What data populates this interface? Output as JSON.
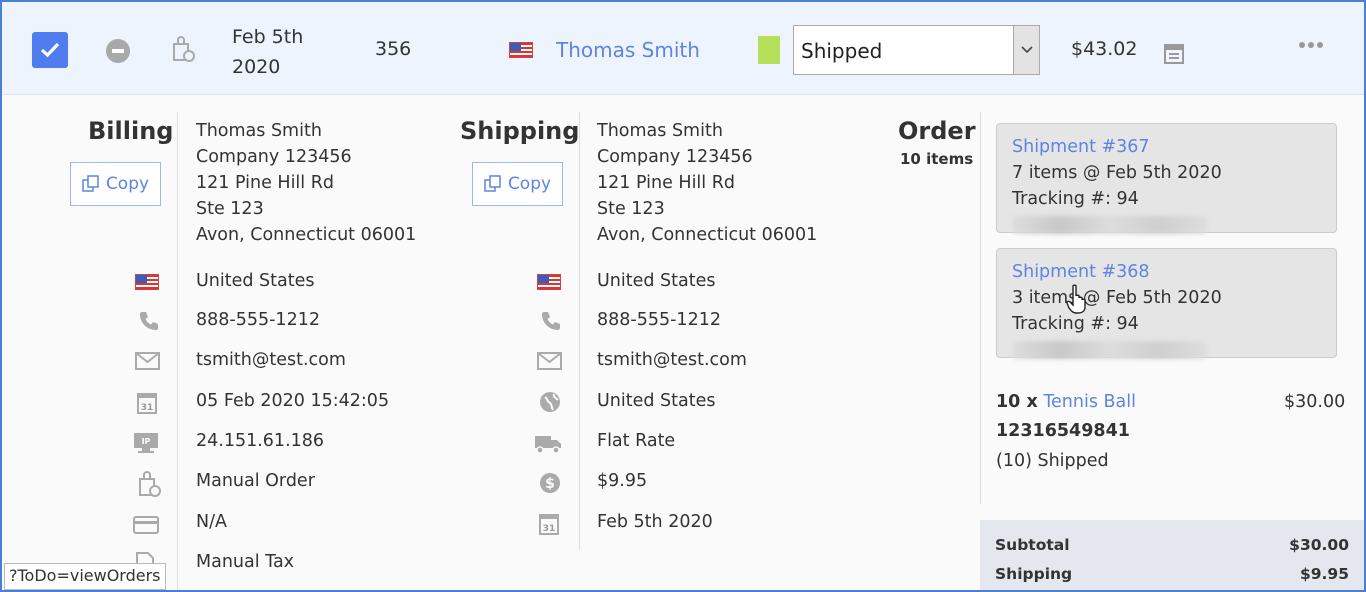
{
  "order_row": {
    "date_line1": "Feb 5th",
    "date_line2": "2020",
    "order_number": "356",
    "customer_name": "Thomas Smith",
    "status_color": "#b4df5b",
    "status_value": "Shipped",
    "total": "$43.02"
  },
  "billing": {
    "heading": "Billing",
    "copy_label": "Copy",
    "address": [
      "Thomas Smith",
      "Company 123456",
      "121 Pine Hill Rd",
      "Ste 123",
      "Avon, Connecticut 06001"
    ],
    "country": "United States",
    "phone": "888-555-1212",
    "email": "tsmith@test.com",
    "datetime": "05 Feb 2020 15:42:05",
    "ip": "24.151.61.186",
    "source": "Manual Order",
    "payment": "N/A",
    "tax": "Manual Tax"
  },
  "shipping": {
    "heading": "Shipping",
    "copy_label": "Copy",
    "address": [
      "Thomas Smith",
      "Company 123456",
      "121 Pine Hill Rd",
      "Ste 123",
      "Avon, Connecticut 06001"
    ],
    "country": "United States",
    "phone": "888-555-1212",
    "email": "tsmith@test.com",
    "region": "United States",
    "method": "Flat Rate",
    "cost": "$9.95",
    "date": "Feb 5th 2020"
  },
  "order": {
    "heading": "Order",
    "items_count": "10 items",
    "shipments": [
      {
        "title": "Shipment #367",
        "summary": "7 items @ Feb 5th 2020",
        "tracking": "Tracking #: 94"
      },
      {
        "title": "Shipment #368",
        "summary": "3 items @ Feb 5th 2020",
        "tracking": "Tracking #: 94"
      }
    ],
    "line_item": {
      "qty": "10 x",
      "name": "Tennis Ball",
      "price": "$30.00",
      "sku": "12316549841",
      "status": "(10) Shipped"
    },
    "totals": [
      {
        "label": "Subtotal",
        "value": "$30.00"
      },
      {
        "label": "Shipping",
        "value": "$9.95"
      }
    ]
  },
  "status_bar_url": "?ToDo=viewOrders"
}
